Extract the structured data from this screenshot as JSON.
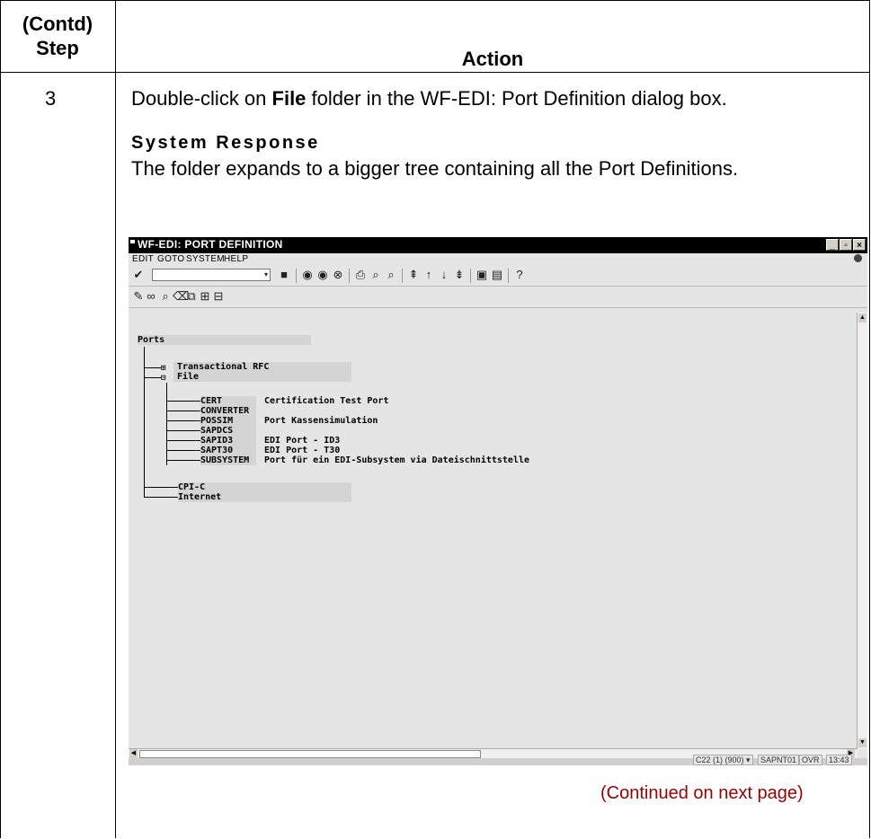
{
  "header": {
    "step_line1": "(Contd)",
    "step_line2": "Step",
    "action": "Action"
  },
  "row": {
    "step": "3",
    "instruction_pre": "Double-click on ",
    "instruction_bold": "File",
    "instruction_post": " folder in the WF-EDI: Port Definition dialog box.",
    "response_title": "System Response",
    "response_text": "The folder expands to a bigger tree containing all the Port Definitions."
  },
  "continued": "(Continued on next page)",
  "sap": {
    "title": "WF-EDI: Port Definition",
    "menu": [
      "Edit",
      "Goto",
      "System",
      "Help"
    ],
    "tree": {
      "root": "Ports",
      "nodes": [
        "Transactional RFC",
        "File",
        "CPI-C",
        "Internet"
      ],
      "ports": [
        {
          "name": "CERT",
          "desc": "Certification Test Port"
        },
        {
          "name": "CONVERTER",
          "desc": ""
        },
        {
          "name": "POSSIM",
          "desc": "Port Kassensimulation"
        },
        {
          "name": "SAPDCS",
          "desc": ""
        },
        {
          "name": "SAPID3",
          "desc": "EDI Port - ID3"
        },
        {
          "name": "SAPT30",
          "desc": "EDI Port - T30"
        },
        {
          "name": "SUBSYSTEM",
          "desc": "Port für ein EDI-Subsystem via Dateischnittstelle"
        }
      ]
    },
    "status": {
      "system": "C22 (1) (900)",
      "server": "SAPNT01",
      "mode": "OVR",
      "time": "13:43"
    }
  }
}
